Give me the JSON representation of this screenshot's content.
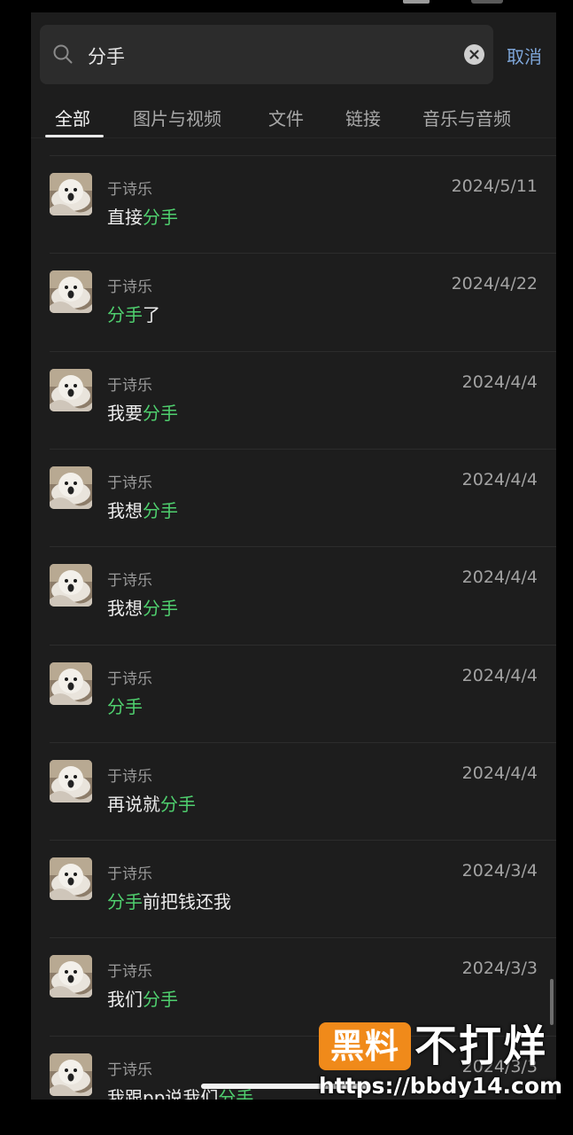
{
  "search": {
    "value": "分手",
    "cancel_label": "取消"
  },
  "tabs": [
    {
      "label": "全部",
      "active": true
    },
    {
      "label": "图片与视频",
      "active": false
    },
    {
      "label": "文件",
      "active": false
    },
    {
      "label": "链接",
      "active": false
    },
    {
      "label": "音乐与音频",
      "active": false
    }
  ],
  "results": [
    {
      "sender": "于诗乐",
      "date": "2024/5/11",
      "before": "直接",
      "match": "分手",
      "after": ""
    },
    {
      "sender": "于诗乐",
      "date": "2024/4/22",
      "before": "",
      "match": "分手",
      "after": "了"
    },
    {
      "sender": "于诗乐",
      "date": "2024/4/4",
      "before": "我要",
      "match": "分手",
      "after": ""
    },
    {
      "sender": "于诗乐",
      "date": "2024/4/4",
      "before": "我想",
      "match": "分手",
      "after": ""
    },
    {
      "sender": "于诗乐",
      "date": "2024/4/4",
      "before": "我想",
      "match": "分手",
      "after": ""
    },
    {
      "sender": "于诗乐",
      "date": "2024/4/4",
      "before": "",
      "match": "分手",
      "after": ""
    },
    {
      "sender": "于诗乐",
      "date": "2024/4/4",
      "before": "再说就",
      "match": "分手",
      "after": ""
    },
    {
      "sender": "于诗乐",
      "date": "2024/3/4",
      "before": "",
      "match": "分手",
      "after": "前把钱还我"
    },
    {
      "sender": "于诗乐",
      "date": "2024/3/3",
      "before": "我们",
      "match": "分手",
      "after": ""
    },
    {
      "sender": "于诗乐",
      "date": "2024/3/3",
      "before": "我跟pp说我们",
      "match": "分手",
      "after": ""
    }
  ],
  "watermark": {
    "badge": "黑料",
    "text": "不打烊",
    "url": "https://bbdy14.com"
  },
  "colors": {
    "highlight": "#4fcf6e",
    "cancel": "#7ea6d9",
    "background": "#1d1d1d"
  }
}
